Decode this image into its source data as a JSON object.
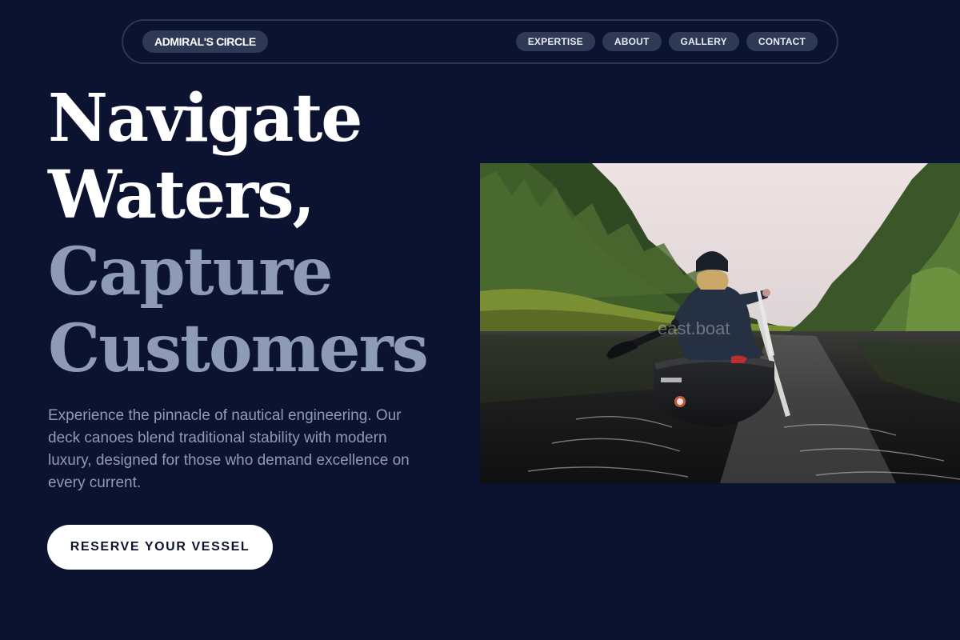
{
  "brand": {
    "name": "ADMIRAL'S CIRCLE"
  },
  "nav": {
    "links": [
      {
        "label": "EXPERTISE"
      },
      {
        "label": "ABOUT"
      },
      {
        "label": "GALLERY"
      },
      {
        "label": "CONTACT"
      }
    ]
  },
  "hero": {
    "headline": {
      "line1": "Navigate",
      "line2": "Waters,",
      "line3": "Capture",
      "line4": "Customers"
    },
    "description": "Experience the pinnacle of nautical engineering. Our deck canoes blend traditional stability with modern luxury, designed for those who demand excellence on every current.",
    "cta_label": "RESERVE YOUR VESSEL",
    "image": {
      "subject": "person paddling a dark canoe on a forest river",
      "watermark": "east.boat"
    }
  },
  "colors": {
    "background": "#0b1330",
    "pill": "#2e3a55",
    "muted_text": "#8d9bb8",
    "cta_bg": "#ffffff"
  }
}
